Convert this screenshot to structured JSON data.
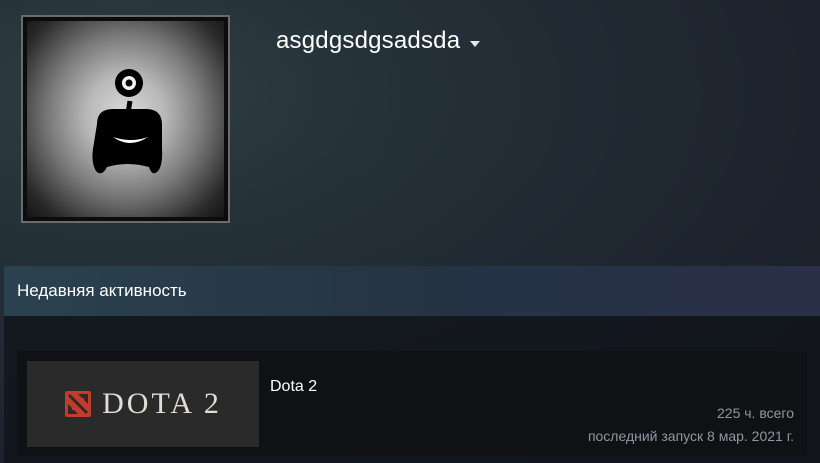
{
  "profile": {
    "username": "asgdgsdgsadsda",
    "avatar_icon": "one-eyed-creature-avatar",
    "dropdown_icon": "caret-down-icon"
  },
  "recent_activity": {
    "title": "Недавняя активность",
    "games": [
      {
        "name": "Dota 2",
        "capsule_text": "DOTA 2",
        "capsule_icon": "dota2-logo-icon",
        "hours": "225 ч. всего",
        "last_played": "последний запуск 8 мар. 2021 г."
      }
    ]
  },
  "colors": {
    "text_primary": "#ffffff",
    "text_muted": "#8f98a0",
    "dota_red": "#c23c2a"
  }
}
